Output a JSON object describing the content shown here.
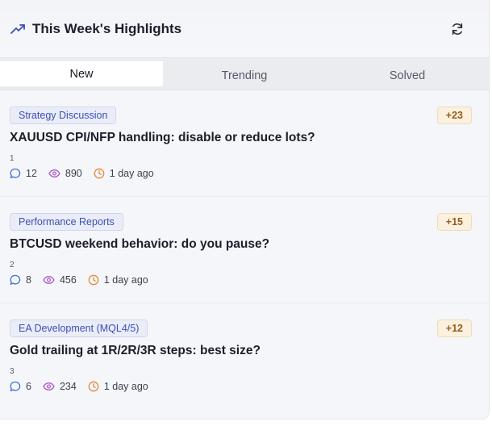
{
  "header": {
    "title": "This Week's Highlights",
    "icon": "trending-up-icon",
    "refresh_icon": "refresh-icon"
  },
  "tabs": [
    {
      "label": "New",
      "active": true
    },
    {
      "label": "Trending",
      "active": false
    },
    {
      "label": "Solved",
      "active": false
    }
  ],
  "items": [
    {
      "category": "Strategy Discussion",
      "score": "+23",
      "title": "XAUUSD CPI/NFP handling: disable or reduce lots?",
      "rank": "1",
      "comments": "12",
      "views": "890",
      "time": "1 day ago"
    },
    {
      "category": "Performance Reports",
      "score": "+15",
      "title": "BTCUSD weekend behavior: do you pause?",
      "rank": "2",
      "comments": "8",
      "views": "456",
      "time": "1 day ago"
    },
    {
      "category": "EA Development (MQL4/5)",
      "score": "+12",
      "title": "Gold trailing at 1R/2R/3R steps: best size?",
      "rank": "3",
      "comments": "6",
      "views": "234",
      "time": "1 day ago"
    }
  ],
  "colors": {
    "accent": "#3b4fb8",
    "comment_icon": "#3b6fd8",
    "view_icon": "#b05acb",
    "time_icon": "#e08a3a",
    "score_text": "#9a5a1a"
  }
}
